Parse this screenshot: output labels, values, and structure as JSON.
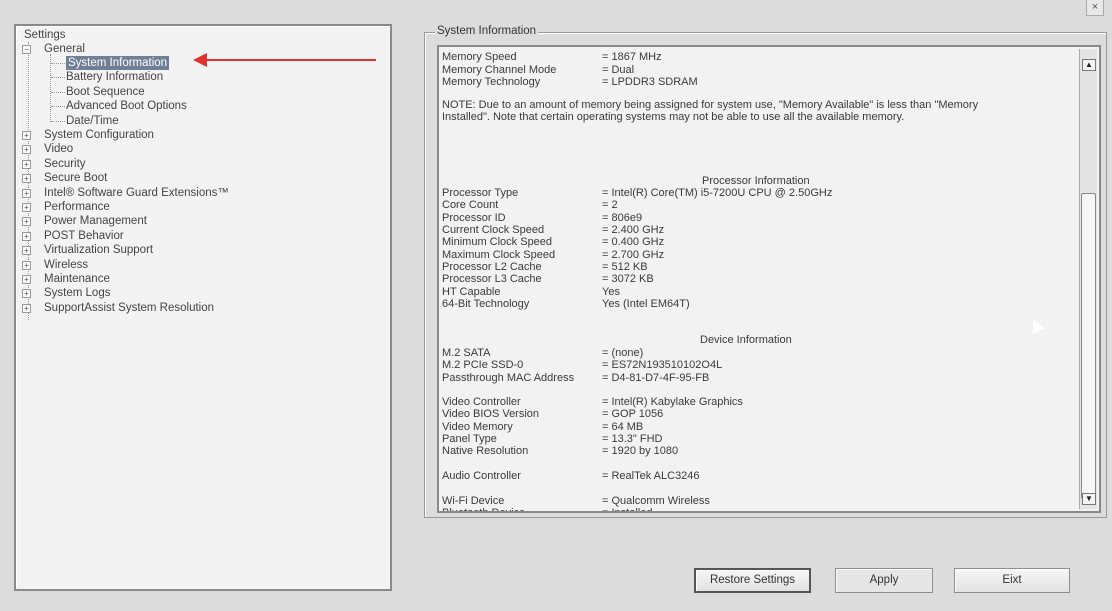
{
  "window": {
    "close_label": "×"
  },
  "tree": {
    "root_label": "Settings",
    "general": {
      "label": "General",
      "expander": "−"
    },
    "general_children": [
      {
        "label": "System Information"
      },
      {
        "label": "Battery Information"
      },
      {
        "label": "Boot Sequence"
      },
      {
        "label": "Advanced Boot Options"
      },
      {
        "label": "Date/Time"
      }
    ],
    "categories": [
      {
        "label": "System Configuration",
        "expander": "+"
      },
      {
        "label": "Video",
        "expander": "+"
      },
      {
        "label": "Security",
        "expander": "+"
      },
      {
        "label": "Secure Boot",
        "expander": "+"
      },
      {
        "label": "Intel® Software Guard Extensions™",
        "expander": "+"
      },
      {
        "label": "Performance",
        "expander": "+"
      },
      {
        "label": "Power Management",
        "expander": "+"
      },
      {
        "label": "POST Behavior",
        "expander": "+"
      },
      {
        "label": "Virtualization Support",
        "expander": "+"
      },
      {
        "label": "Wireless",
        "expander": "+"
      },
      {
        "label": "Maintenance",
        "expander": "+"
      },
      {
        "label": "System Logs",
        "expander": "+"
      },
      {
        "label": "SupportAssist System Resolution",
        "expander": "+"
      }
    ]
  },
  "annotation": {
    "arrow_color": "#e0332d"
  },
  "info": {
    "group_title": "System Information",
    "memory": [
      {
        "key": "Memory Speed",
        "value": "= 1867 MHz"
      },
      {
        "key": "Memory Channel Mode",
        "value": "= Dual"
      },
      {
        "key": "Memory Technology",
        "value": "= LPDDR3 SDRAM"
      }
    ],
    "note": "NOTE: Due to an amount of memory being assigned for system use, \"Memory Available\" is less than \"Memory Installed\". Note that certain operating systems may not be able to use all the available memory.",
    "processor_title": "Processor Information",
    "processor": [
      {
        "key": "Processor Type",
        "value": "= Intel(R) Core(TM) i5-7200U CPU @ 2.50GHz"
      },
      {
        "key": "Core Count",
        "value": "= 2"
      },
      {
        "key": "Processor ID",
        "value": "= 806e9"
      },
      {
        "key": "Current Clock Speed",
        "value": "= 2.400 GHz"
      },
      {
        "key": "Minimum Clock Speed",
        "value": "= 0.400 GHz"
      },
      {
        "key": "Maximum Clock Speed",
        "value": "= 2.700 GHz"
      },
      {
        "key": "Processor L2 Cache",
        "value": "= 512 KB"
      },
      {
        "key": "Processor L3 Cache",
        "value": "= 3072 KB"
      },
      {
        "key": "HT Capable",
        "value": "Yes"
      },
      {
        "key": "64-Bit Technology",
        "value": "Yes (Intel EM64T)"
      }
    ],
    "device_title": "Device Information",
    "storage": [
      {
        "key": "M.2 SATA",
        "value": "= (none)"
      },
      {
        "key": "M.2 PCIe SSD-0",
        "value": "= ES72N193510102O4L"
      },
      {
        "key": "Passthrough MAC Address",
        "value": "= D4-81-D7-4F-95-FB"
      }
    ],
    "video": [
      {
        "key": "Video Controller",
        "value": "= Intel(R) Kabylake Graphics"
      },
      {
        "key": "Video BIOS Version",
        "value": "= GOP 1056"
      },
      {
        "key": "Video Memory",
        "value": "= 64 MB"
      },
      {
        "key": "Panel Type",
        "value": "= 13.3\" FHD"
      },
      {
        "key": "Native Resolution",
        "value": "= 1920 by 1080"
      }
    ],
    "audio": [
      {
        "key": "Audio Controller",
        "value": "= RealTek ALC3246"
      }
    ],
    "wireless": [
      {
        "key": "Wi-Fi Device",
        "value": "= Qualcomm Wireless"
      },
      {
        "key": "Bluetooth Device",
        "value": "= Installed"
      }
    ],
    "scroll_up": "▲",
    "scroll_down": "▼"
  },
  "buttons": {
    "restore": "Restore Settings",
    "apply": "Apply",
    "exit": "Eixt"
  }
}
